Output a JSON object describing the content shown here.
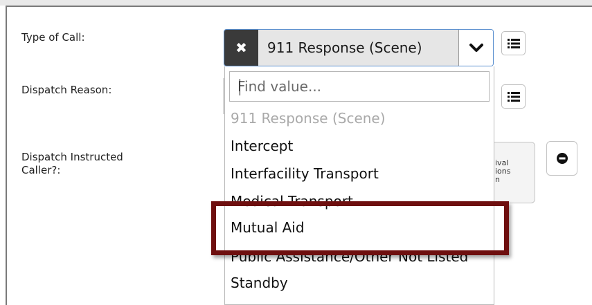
{
  "form": {
    "type_of_call_label": "Type of Call:",
    "dispatch_reason_label": "Dispatch Reason:",
    "dispatch_instructed_label_line1": "Dispatch Instructed",
    "dispatch_instructed_label_line2": "Caller?:",
    "selected_value": "911 Response (Scene)",
    "partial_button_lines": [
      "ival",
      "ions",
      "n"
    ]
  },
  "dropdown": {
    "search_placeholder": "Find value...",
    "options": [
      {
        "label": "911 Response (Scene)",
        "disabled": true
      },
      {
        "label": "Intercept"
      },
      {
        "label": "Interfacility Transport"
      },
      {
        "label": "Medical Transport"
      },
      {
        "label": "Mutual Aid",
        "highlighted": true
      },
      {
        "label": "Public Assistance/Other Not Listed"
      },
      {
        "label": "Standby"
      }
    ]
  },
  "icons": {
    "clear": "times-icon",
    "chevron": "chevron-down-icon",
    "list": "list-icon",
    "minus": "minus-circle-icon"
  },
  "colors": {
    "focus_border": "#5a8fcf",
    "highlight_border": "#6e0f0f",
    "disabled_text": "#a9a9a9",
    "clear_bg": "#3a3a3a"
  }
}
